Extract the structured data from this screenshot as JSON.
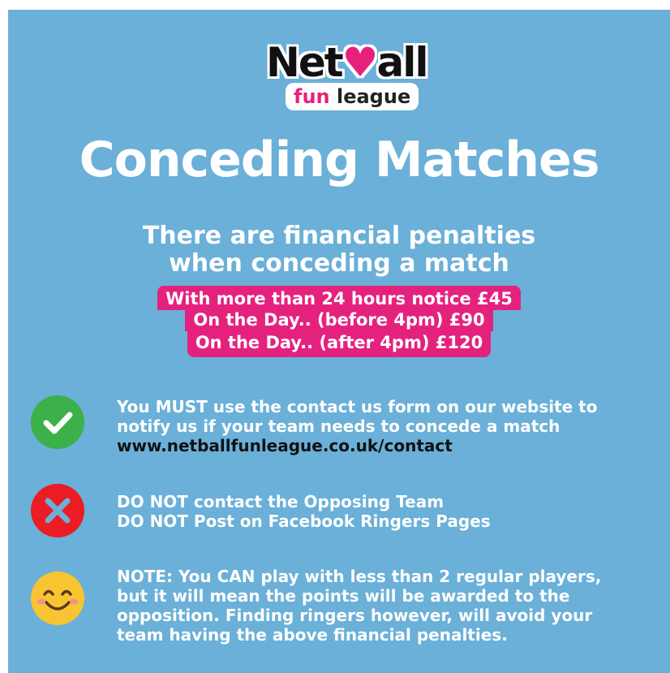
{
  "logo": {
    "word_start": "Net",
    "word_heart": "♥",
    "word_end": "all",
    "sub_fun": "fun",
    "sub_league": "league"
  },
  "title": "Conceding Matches",
  "subtitle": {
    "line1": "There are financial penalties",
    "line2": "when conceding a match"
  },
  "fees": [
    "With more than 24 hours notice £45",
    "On the Day.. (before 4pm) £90",
    "On the Day.. (after 4pm) £120"
  ],
  "items": {
    "must": {
      "icon": "check-icon",
      "color": "#3cb049",
      "line1": "You MUST use the contact us form on our website to",
      "line2": "notify us if your team needs to concede a match",
      "link": "www.netballfunleague.co.uk/contact"
    },
    "donot": {
      "icon": "cross-icon",
      "color": "#ec1c24",
      "line1": "DO NOT contact the Opposing Team",
      "line2": "DO NOT Post on Facebook Ringers Pages"
    },
    "note": {
      "icon": "smiley-icon",
      "color": "#f9c431",
      "line1": "NOTE: You CAN play with less than 2 regular players,",
      "line2": "but it will mean the points will be awarded to the",
      "line3": "opposition. Finding ringers however, will avoid your",
      "line4": "team having the above financial penalties."
    }
  },
  "colors": {
    "background": "#6ab0d8",
    "accent_pink": "#e4227e",
    "text": "#ffffff"
  }
}
